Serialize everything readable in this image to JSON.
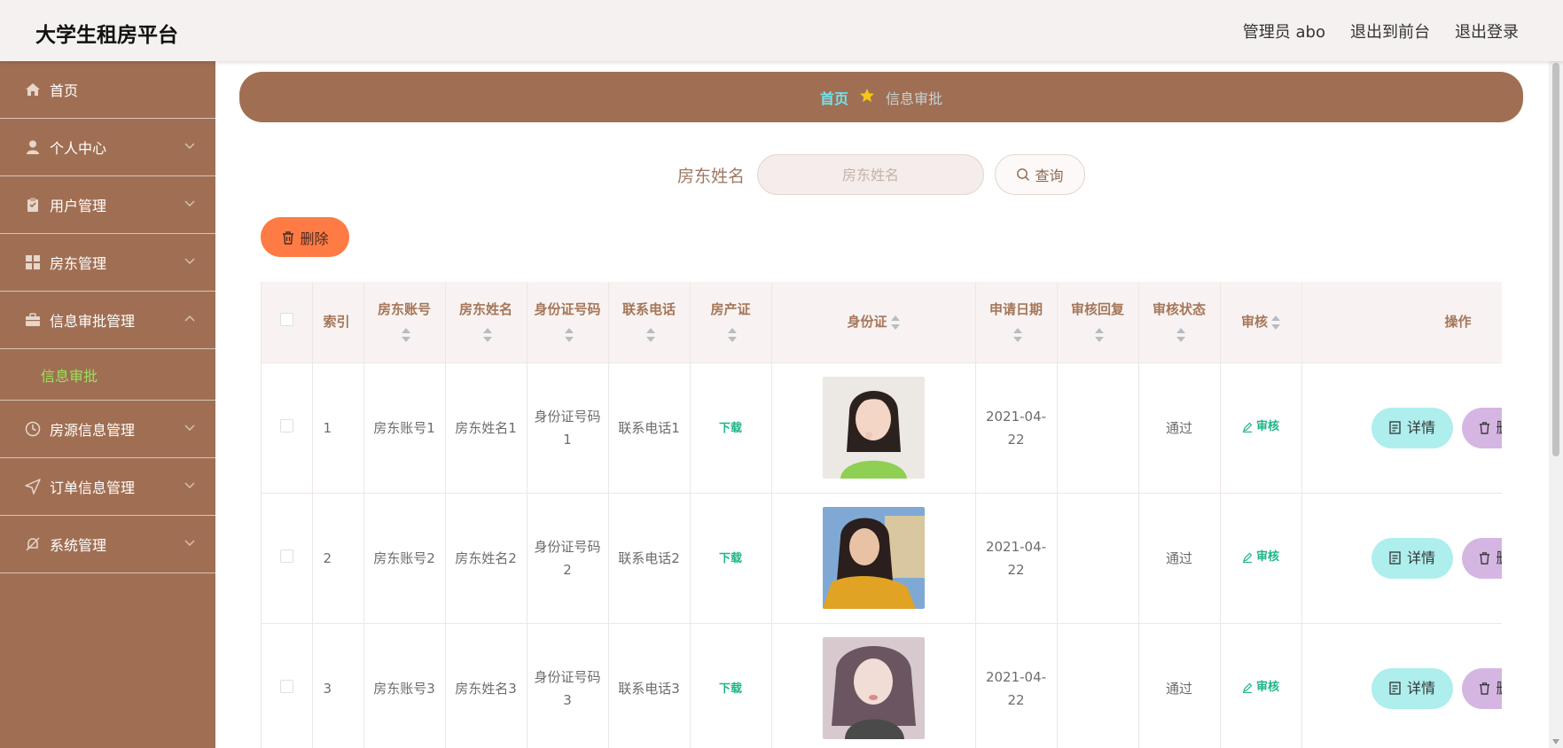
{
  "header": {
    "brand": "大学生租房平台",
    "user_label": "管理员 abo",
    "to_front_label": "退出到前台",
    "logout_label": "退出登录"
  },
  "sidebar": {
    "items": [
      {
        "label": "首页",
        "icon": "home-icon"
      },
      {
        "label": "个人中心",
        "icon": "user-icon"
      },
      {
        "label": "用户管理",
        "icon": "clipboard-icon"
      },
      {
        "label": "房东管理",
        "icon": "grid-icon"
      },
      {
        "label": "信息审批管理",
        "icon": "briefcase-icon",
        "expanded": true
      },
      {
        "label": "房源信息管理",
        "icon": "clock-icon"
      },
      {
        "label": "订单信息管理",
        "icon": "send-icon"
      },
      {
        "label": "系统管理",
        "icon": "bell-off-icon"
      }
    ],
    "sub_item": "信息审批"
  },
  "breadcrumb": {
    "home": "首页",
    "current": "信息审批"
  },
  "search": {
    "label": "房东姓名",
    "placeholder": "房东姓名",
    "button_label": "查询"
  },
  "toolbar": {
    "delete_label": "删除"
  },
  "table": {
    "columns": {
      "index": "索引",
      "account": "房东账号",
      "name": "房东姓名",
      "id_number": "身份证号码",
      "phone": "联系电话",
      "property_cert": "房产证",
      "id_card": "身份证",
      "apply_date": "申请日期",
      "reply": "审核回复",
      "status": "审核状态",
      "audit": "审核",
      "ops": "操作"
    },
    "rows": [
      {
        "index": "1",
        "account": "房东账号1",
        "name": "房东姓名1",
        "id_number": "身份证号码1",
        "phone": "联系电话1",
        "cert_link": "下载",
        "apply_date": "2021-04-22",
        "reply": "",
        "status": "通过",
        "audit_link": "审核",
        "detail_label": "详情",
        "delete_label": "删"
      },
      {
        "index": "2",
        "account": "房东账号2",
        "name": "房东姓名2",
        "id_number": "身份证号码2",
        "phone": "联系电话2",
        "cert_link": "下载",
        "apply_date": "2021-04-22",
        "reply": "",
        "status": "通过",
        "audit_link": "审核",
        "detail_label": "详情",
        "delete_label": "删"
      },
      {
        "index": "3",
        "account": "房东账号3",
        "name": "房东姓名3",
        "id_number": "身份证号码3",
        "phone": "联系电话3",
        "cert_link": "下载",
        "apply_date": "2021-04-22",
        "reply": "",
        "status": "通过",
        "audit_link": "审核",
        "detail_label": "详情",
        "delete_label": "删"
      }
    ]
  },
  "colors": {
    "brand_brown": "#a06f53",
    "accent_orange": "#ff7b45",
    "accent_cyan": "#aeeeed",
    "accent_purple": "#d5b6e3",
    "link_green": "#1fb489"
  }
}
